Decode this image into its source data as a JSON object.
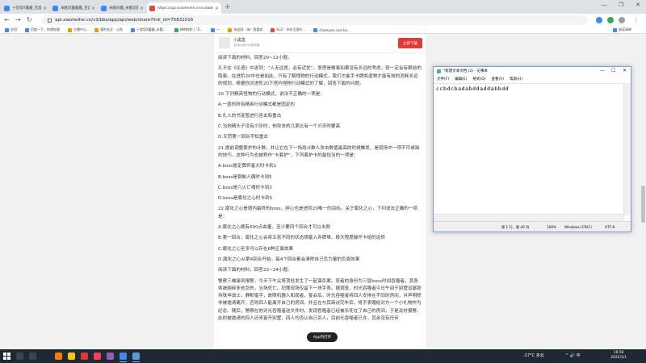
{
  "browser": {
    "tabs": [
      {
        "title": "十堂塔X露露_百度Al_百度搜索",
        "active": false
      },
      {
        "title": "米酷玩露露露_百度AI搜索",
        "active": false
      },
      {
        "title": "米酷白露_米酷玩露露AI搜索",
        "active": false
      },
      {
        "title": "https://api.xiaoheihe.cn/v3/bbs/",
        "active": true
      }
    ],
    "new_tab": "+",
    "url": "api.xiaoheihe.cn/v3/bbs/app/api/web/share?link_id=75831016",
    "bookmarks": [
      {
        "label": "应用",
        "icon": "apps-icon"
      },
      {
        "label": "百度一下，你就知道",
        "icon": "baidu-icon"
      },
      {
        "label": "主播中心",
        "icon": "bookmark-icon"
      },
      {
        "label": "我的关注 - 斗鱼",
        "icon": "douyu-icon"
      },
      {
        "label": "十堂塔X露露_米酷...",
        "icon": "bookmark-icon"
      },
      {
        "label": "神明转职 | ”D...",
        "icon": "bookmark-icon"
      },
      {
        "label": "一",
        "icon": "bookmark-icon"
      },
      {
        "label": "淘宝网 - 淘！我喜欢",
        "icon": "taobao-icon"
      },
      {
        "label": "AuZ - 冰封王国外...",
        "icon": "bookmark-icon"
      },
      {
        "label": "champion and bo...",
        "icon": "bookmark-icon"
      }
    ],
    "reading_list": "阅读清单"
  },
  "page": {
    "app_banner": {
      "name": "小黑盒",
      "subtitle": "游戏玩家的必备神器",
      "download": "立即下载"
    },
    "paragraphs": [
      "阅读下面的材料，回答20~22小题。",
      "孔子在《论语》中说到：“人无远虑，必有近忧”。意思是做事如果没有长远的考虑，就一定会有眼前的隐患。在进阶20中也是如此，只有了解怪物的行动模式，我们才能手卡牌和遗物才能有效的消耗长远的规划，根据你对进阶20下塔内怪物行动模式的了解，回答下面的问题。",
      "20.下列精英怪物的行动模式，说法不正确的一项是：",
      "A.一层的所有精英行动模式都是固定的",
      "B.扎人的书变暂进行连击和重击",
      "C.当地精头子没有爪牙时，他攻击的几率比有一个爪牙时要高",
      "D.天罚第一回合不知重击",
      "21.提前调整套护的计数，并让它在下一场战斗数人攻击数值最高的时候触发，是现场中一项不可或缺的技巧，这种行为也被称作“卡套护”。下列套护卡的最恰当的一项是：",
      "A.boss是定葬师者大时卡到2",
      "B.boss是铜制人偶时卡到5",
      "C.boss是六火亡魂时卡到3",
      "D.boss是腐化之心时卡到5",
      "22.腐化之心是塔内最终的boss，碎心也是进阶20唯一的目标。关于腐化之心，下列说法正确的一项是：",
      "A.腐化之心拥有600点血量，至少要四个回合才可以击败",
      "B.第一回合，腐化之心会将五张不同的状态牌塞入弃牌堆，极大程度破坏卡组的运转",
      "C.腐化之心至多可以存在6种正面效果",
      "D.腐化之心从第4回合开始，每4个回合都会清除自己负力量的负面效果",
      "阅读下面的材料，回答23~24小题。",
      "警察三佛接到报警，今天下午尖塔顶处发生了一起谋杀案。死者的身份为三层boss时间吞噬者，其身体被砸碎多处剑伤，当场死亡。犯罪现场仅留下一块手表。据调查，时光吞噬者今日午间于别墅设宴款待铁甲战士，静默猎手，故障机器人和观者，宴会后，时光吞噬者将四人安排在不同的房间，并声明除非被邀请离开，否则四人能离开自己的房间。并且在与其商谈完毕后，将手表赠给对方一个小礼物作为纪念。随后，警察在他对光吞噬者送文件时，发现吞噬者已经被杀死在了自己的房间，于是及时报警。此时被邀请的四人还来宴开别墅，四人均否认自己杀人，目前光吞噬者已许，其余没有任何"
    ],
    "app_open": "App内打开"
  },
  "notepad": {
    "title": "*新建文本文档 (2) - 记事本",
    "menus": [
      "文件(F)",
      "编辑(E)",
      "格式(O)",
      "查看(V)",
      "帮助(H)"
    ],
    "content": "ccbdcbadabddaddabbdd",
    "status": {
      "position": "第 1 行，第 40 列",
      "zoom": "100%",
      "line_ending": "Windows (CRLF)",
      "encoding": "UTF-8"
    }
  },
  "taskbar": {
    "weather": "-17°C 多云",
    "time": "16:56",
    "date": "2022/1/1",
    "tray": "^ 🔊 中"
  }
}
